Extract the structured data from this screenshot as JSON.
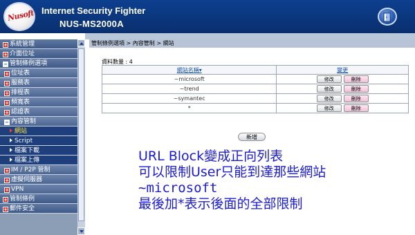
{
  "header": {
    "logo_text": "Nusoft",
    "title": "Internet Security Fighter",
    "model": "NUS-MS2000A",
    "exit_icon": "door-exit-icon"
  },
  "sidebar": {
    "items": [
      {
        "label": "系統管理",
        "level": 0,
        "icon": "plus"
      },
      {
        "label": "介面位址",
        "level": 0,
        "icon": "plus"
      },
      {
        "label": "管制條例選項",
        "level": 0,
        "icon": "minus"
      },
      {
        "label": "位址表",
        "level": 1,
        "icon": "plus"
      },
      {
        "label": "服務表",
        "level": 1,
        "icon": "plus"
      },
      {
        "label": "排程表",
        "level": 1,
        "icon": "plus"
      },
      {
        "label": "頻寬表",
        "level": 1,
        "icon": "plus"
      },
      {
        "label": "認證表",
        "level": 1,
        "icon": "plus"
      },
      {
        "label": "內容管制",
        "level": 1,
        "icon": "minus"
      },
      {
        "label": "網站",
        "level": 2,
        "active": true
      },
      {
        "label": "Script",
        "level": 2
      },
      {
        "label": "檔案下載",
        "level": 2
      },
      {
        "label": "檔案上傳",
        "level": 2
      },
      {
        "label": "IM / P2P 管制",
        "level": 1,
        "icon": "plus"
      },
      {
        "label": "虛擬伺服器",
        "level": 1,
        "icon": "plus"
      },
      {
        "label": "VPN",
        "level": 1,
        "icon": "plus"
      },
      {
        "label": "管制條例",
        "level": 0,
        "icon": "plus"
      },
      {
        "label": "郵件安全",
        "level": 0,
        "icon": "plus"
      }
    ]
  },
  "main": {
    "breadcrumb": "管制條例選項 > 內容管制 > 網站",
    "count_label": "資料數量 : 4",
    "table": {
      "headers": [
        "網站名稱▾",
        "變更"
      ],
      "rows": [
        {
          "name": "~microsoft",
          "edit": "修改",
          "delete": "刪除"
        },
        {
          "name": "~trend",
          "edit": "修改",
          "delete": "刪除"
        },
        {
          "name": "~symantec",
          "edit": "修改",
          "delete": "刪除"
        },
        {
          "name": "*",
          "edit": "修改",
          "delete": "刪除"
        }
      ]
    },
    "add_label": "新增"
  },
  "annotation": {
    "lines": [
      "URL Block變成正向列表",
      "可以限制User只能到達那些網站",
      "~microsoft",
      "最後加*表示後面的全部限制"
    ]
  },
  "colors": {
    "header_bg": "#0d3f8f",
    "sidebar_active_text": "#ffe23b",
    "annotation_text": "#1a1ad6",
    "table_header_text": "#1a53a6"
  }
}
